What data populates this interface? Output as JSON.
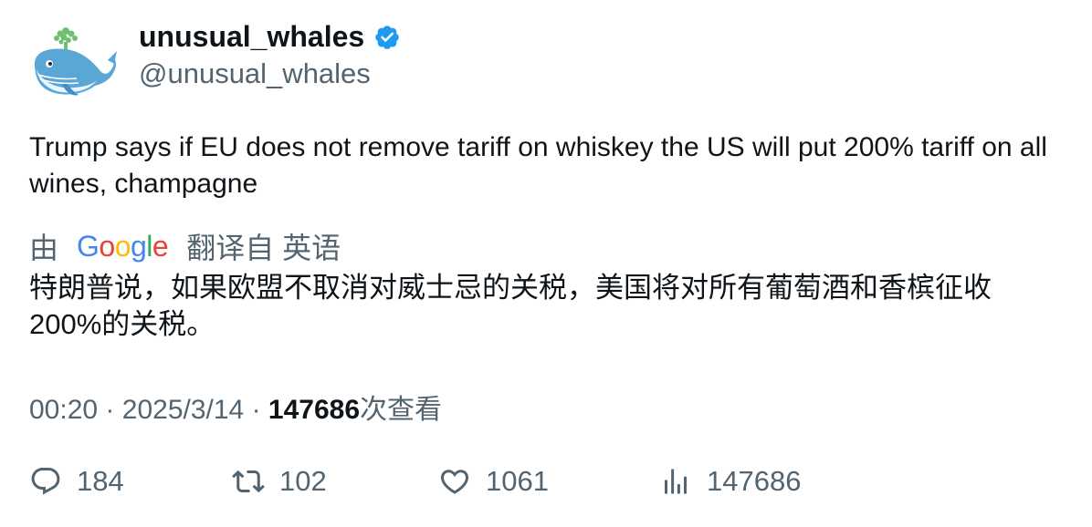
{
  "author": {
    "display_name": "unusual_whales",
    "handle": "@unusual_whales",
    "verified": true,
    "avatar_icon": "whale-avatar-icon",
    "verified_color": "#1d9bf0"
  },
  "tweet": {
    "text": "Trump says if EU does not remove tariff on whiskey the US will put 200% tariff on all wines, champagne"
  },
  "translation": {
    "prefix": "由",
    "provider": "Google",
    "suffix": "翻译自 英语",
    "text": "特朗普说，如果欧盟不取消对威士忌的关税，美国将对所有葡萄酒和香槟征收200%的关税。"
  },
  "meta": {
    "time": "00:20",
    "separator": "·",
    "date": "2025/3/14",
    "views_count": "147686",
    "views_label": "次查看"
  },
  "actions": {
    "replies": "184",
    "retweets": "102",
    "likes": "1061",
    "views": "147686"
  }
}
